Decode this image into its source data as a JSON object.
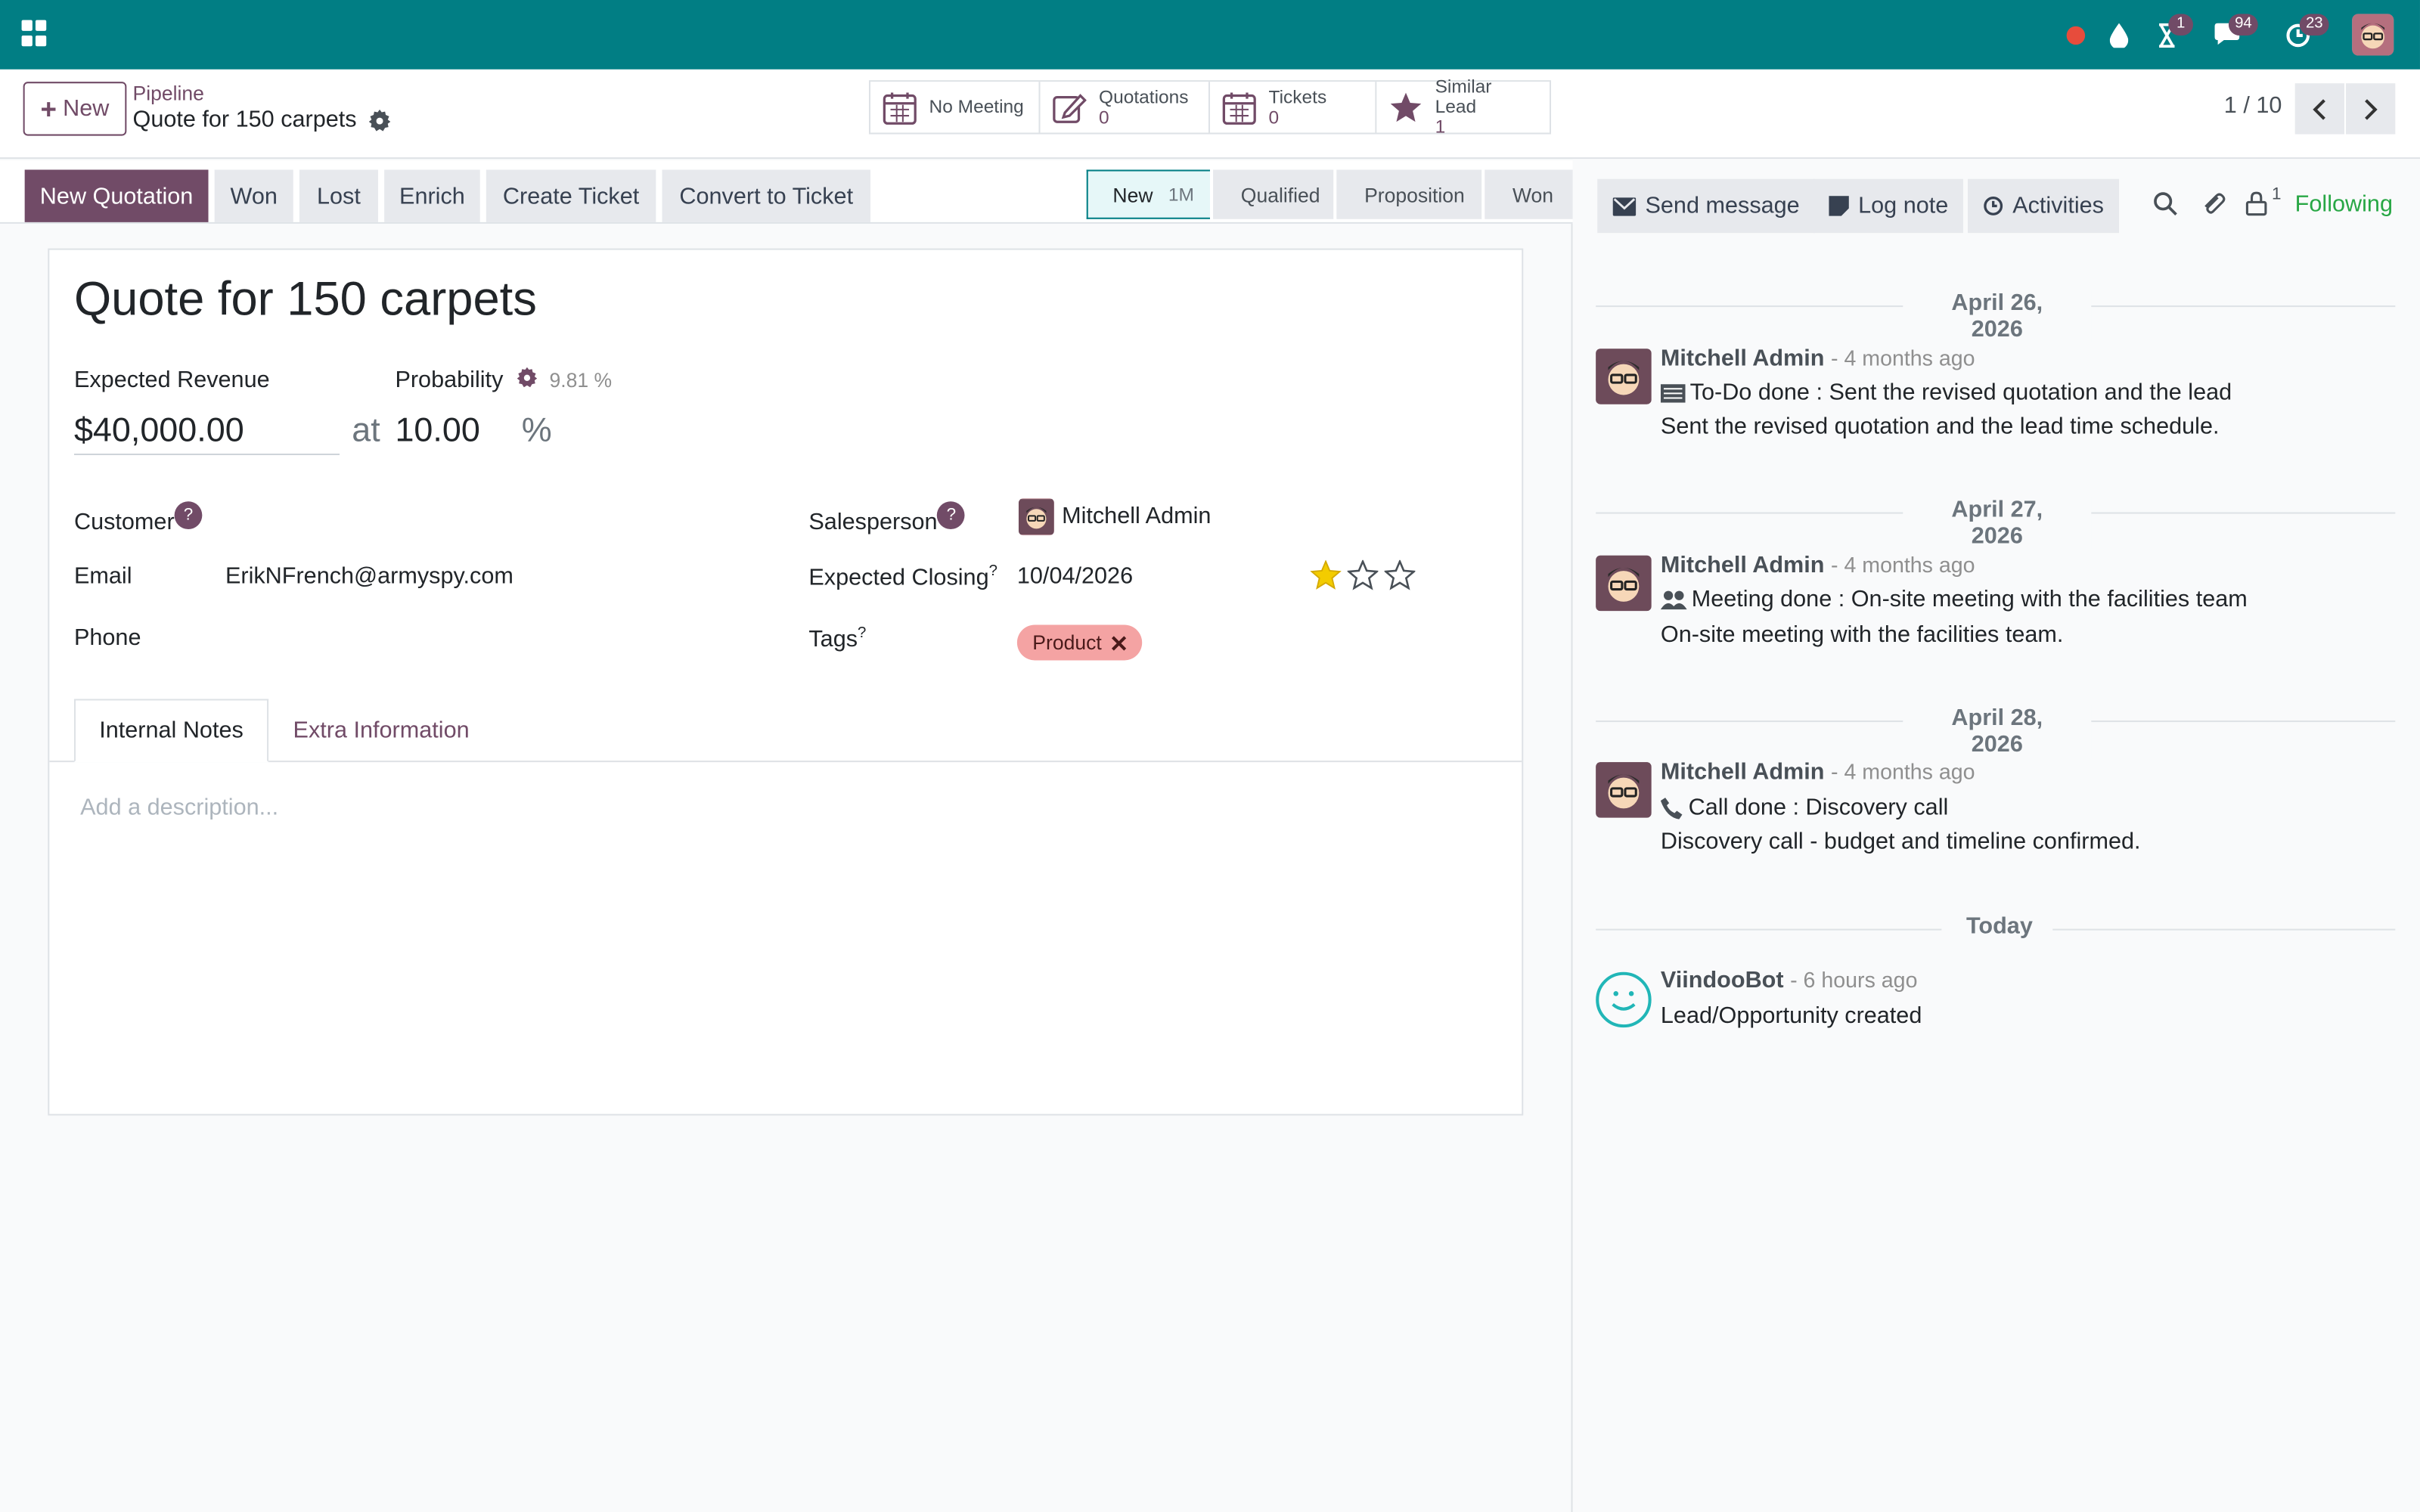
{
  "colors": {
    "brand": "#017e84",
    "primary": "#714b67",
    "following": "#28a745",
    "tag": "#f4a3a3",
    "star": "#f3cc00"
  },
  "navbar": {
    "apps_icon": "apps-grid-icon",
    "systray": [
      {
        "icon": "record-dot-icon",
        "badge": ""
      },
      {
        "icon": "drop-icon",
        "badge": ""
      },
      {
        "icon": "hourglass-icon",
        "badge": "1"
      },
      {
        "icon": "chat-icon",
        "badge": "94"
      },
      {
        "icon": "clock-icon",
        "badge": "23"
      }
    ]
  },
  "control_panel": {
    "new_label": "New",
    "breadcrumb_parent": "Pipeline",
    "breadcrumb_current": "Quote for 150 carpets",
    "smart_buttons": [
      {
        "label": "No Meeting",
        "count": "",
        "icon": "calendar-icon"
      },
      {
        "label": "Quotations",
        "count": "0",
        "icon": "edit-icon"
      },
      {
        "label": "Tickets",
        "count": "0",
        "icon": "calendar-icon"
      },
      {
        "label": "Similar Lead",
        "count": "1",
        "icon": "star-icon"
      }
    ],
    "pager": "1 / 10"
  },
  "actions": [
    "New Quotation",
    "Won",
    "Lost",
    "Enrich",
    "Create Ticket",
    "Convert to Ticket"
  ],
  "stages": [
    {
      "label": "New",
      "sub": "1M",
      "active": true
    },
    {
      "label": "Qualified",
      "sub": "",
      "active": false
    },
    {
      "label": "Proposition",
      "sub": "",
      "active": false
    },
    {
      "label": "Won",
      "sub": "",
      "active": false
    }
  ],
  "form": {
    "title": "Quote for 150 carpets",
    "expected_revenue_label": "Expected Revenue",
    "expected_revenue": "$40,000.00",
    "at": "at",
    "probability_label": "Probability",
    "auto_probability": "9.81 %",
    "probability": "10.00",
    "percent": "%",
    "customer_label": "Customer",
    "email_label": "Email",
    "email": "ErikNFrench@armyspy.com",
    "phone_label": "Phone",
    "salesperson_label": "Salesperson",
    "salesperson": "Mitchell Admin",
    "closing_label": "Expected Closing",
    "closing": "10/04/2026",
    "priority": 1,
    "priority_max": 3,
    "tags_label": "Tags",
    "tag": "Product",
    "help_mark": "?",
    "tabs": [
      "Internal Notes",
      "Extra Information"
    ],
    "description_placeholder": "Add a description..."
  },
  "chatter": {
    "send_message": "Send message",
    "log_note": "Log note",
    "activities": "Activities",
    "followers_count": "1",
    "following": "Following",
    "groups": [
      {
        "date": "April 26, 2026",
        "author": "Mitchell Admin",
        "when": "- 4 months ago",
        "line1": "To-Do done : Sent the revised quotation and the lead",
        "line2": "Sent the revised quotation and the lead time schedule.",
        "icon": "todo-icon"
      },
      {
        "date": "April 27, 2026",
        "author": "Mitchell Admin",
        "when": "- 4 months ago",
        "line1": "Meeting done : On-site meeting with the facilities team",
        "line2": "On-site meeting with the facilities team.",
        "icon": "users-icon"
      },
      {
        "date": "April 28, 2026",
        "author": "Mitchell Admin",
        "when": "- 4 months ago",
        "line1": "Call done : Discovery call",
        "line2": "Discovery call - budget and timeline confirmed.",
        "icon": "phone-icon"
      },
      {
        "date": "Today",
        "author": "ViindooBot",
        "when": "- 6 hours ago",
        "line1": "Lead/Opportunity created",
        "line2": "",
        "icon": ""
      }
    ]
  }
}
